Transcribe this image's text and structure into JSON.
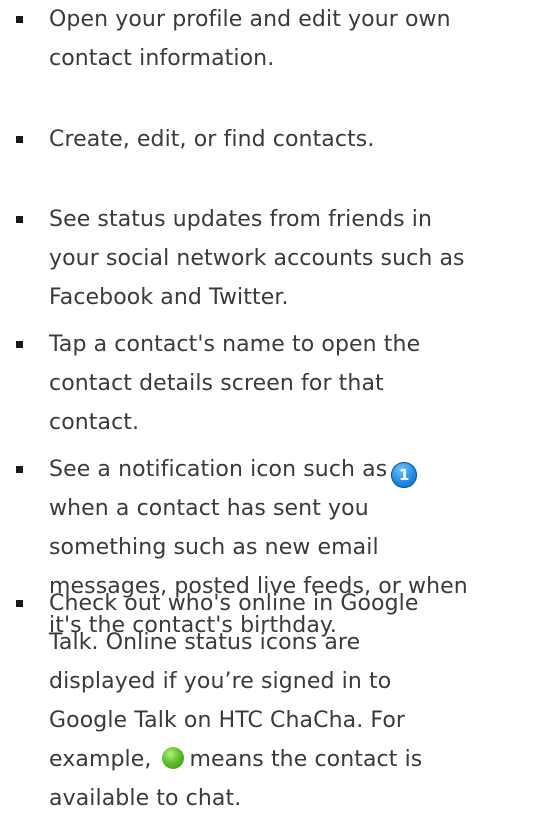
{
  "bullets": [
    {
      "lines": [
        "Open your profile and edit your own",
        "contact information."
      ]
    },
    {
      "lines": [
        "Create, edit, or find contacts."
      ]
    },
    {
      "lines": [
        "See status updates from friends in",
        "your social network accounts such as",
        "Facebook and Twitter."
      ]
    },
    {
      "lines": [
        "Tap a contact's name to open the",
        "contact details screen for that",
        "contact."
      ]
    },
    {
      "line1_prefix": "See a notification icon such as",
      "icon_label": "1",
      "lines_rest": [
        "when a contact has sent you",
        "something such as new email",
        "messages, posted live feeds, or when",
        "it's the contact's birthday."
      ]
    },
    {
      "lines": [
        "Check out who's online in Google",
        "Talk. Online status icons are",
        "displayed if you’re signed in to",
        "Google Talk on HTC ChaCha. For"
      ],
      "line5_prefix": "example,",
      "line5_suffix": "means the contact is",
      "line6": "available to chat."
    }
  ],
  "icons": {
    "notification": "notification-count-icon",
    "online": "online-status-icon"
  },
  "colors": {
    "text": "#3a3a3a",
    "notification_blue": "#1f8ae0",
    "online_green": "#5fc02a"
  }
}
